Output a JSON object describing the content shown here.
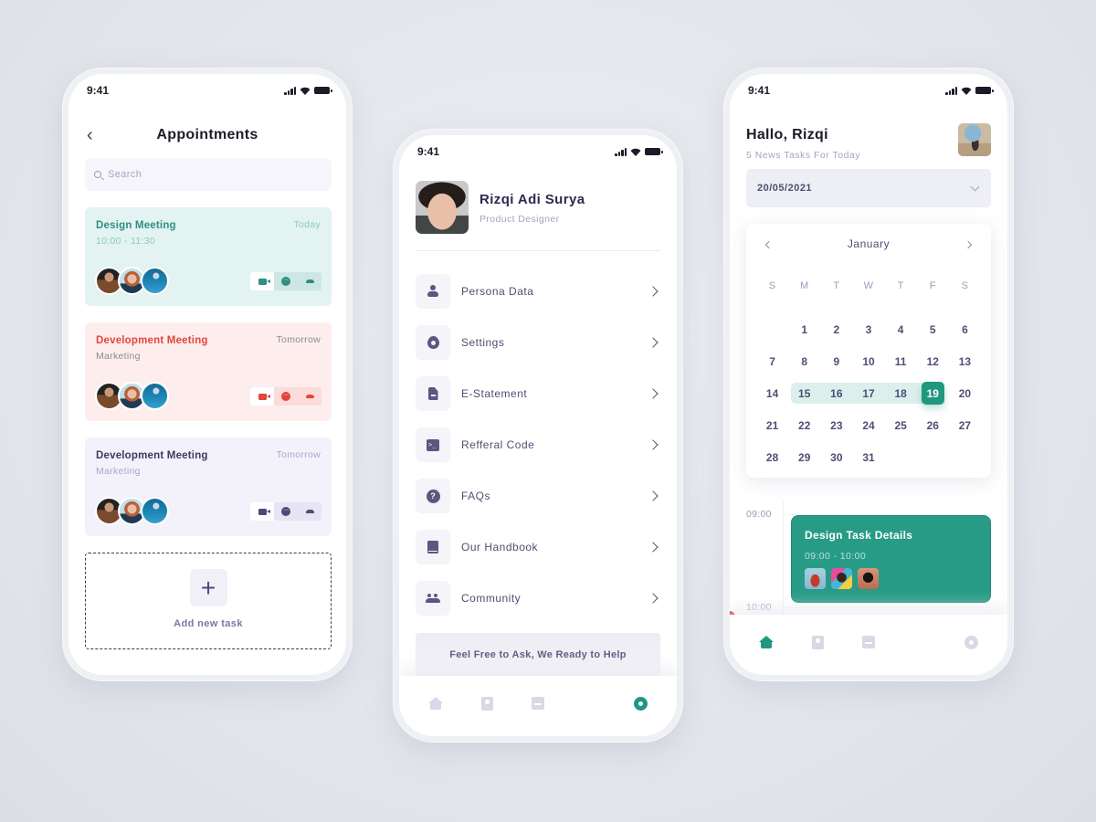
{
  "status_bar": {
    "time": "9:41"
  },
  "appointments_screen": {
    "title": "Appointments",
    "search": {
      "placeholder": "Search",
      "value": ""
    },
    "cards": [
      {
        "title": "Design Meeting",
        "subtitle": "10:00 - 11:30",
        "when": "Today",
        "theme": "teal",
        "accent": "#2f8f83"
      },
      {
        "title": "Development Meeting",
        "subtitle": "Marketing",
        "when": "Tomorrow",
        "theme": "red",
        "accent": "#e2453c"
      },
      {
        "title": "Development Meeting",
        "subtitle": "Marketing",
        "when": "Tomorrow",
        "theme": "purple",
        "accent": "#4d4a7a"
      }
    ],
    "card_actions": [
      "video-call",
      "chat",
      "phone-call"
    ],
    "add_task_label": "Add new task",
    "add_task_icon": "+"
  },
  "profile_screen": {
    "name": "Rizqi Adi Surya",
    "role": "Product Designer",
    "menu": [
      {
        "label": "Persona Data",
        "icon": "person-icon"
      },
      {
        "label": "Settings",
        "icon": "gear-icon"
      },
      {
        "label": "E-Statement",
        "icon": "document-icon"
      },
      {
        "label": "Refferal Code",
        "icon": "terminal-icon"
      },
      {
        "label": "FAQs",
        "icon": "help-icon"
      },
      {
        "label": "Our Handbook",
        "icon": "book-icon"
      },
      {
        "label": "Community",
        "icon": "group-icon"
      }
    ],
    "help_banner": "Feel Free to Ask, We Ready to Help",
    "terminal_glyph": ">_",
    "help_glyph": "?",
    "active_tab": "settings"
  },
  "home_screen": {
    "greeting": "Hallo, Rizqi",
    "subtitle": "5 News Tasks For Today",
    "date_value": "20/05/2021",
    "calendar": {
      "month": "January",
      "weekdays": [
        "S",
        "M",
        "T",
        "W",
        "T",
        "F",
        "S"
      ],
      "first_weekday_offset": 1,
      "days_in_month": 31,
      "range": [
        15,
        19
      ],
      "selected": 19
    },
    "timeline": {
      "labels": [
        "09:00",
        "10:00"
      ],
      "task": {
        "title": "Design Task Details",
        "time": "09:00 - 10:00",
        "attendees": 3
      }
    },
    "active_tab": "home",
    "accent": "#22977f"
  },
  "tabbar": {
    "tabs": [
      "home",
      "contacts",
      "calendar",
      "messages",
      "settings"
    ],
    "chat_glyph": "···"
  }
}
